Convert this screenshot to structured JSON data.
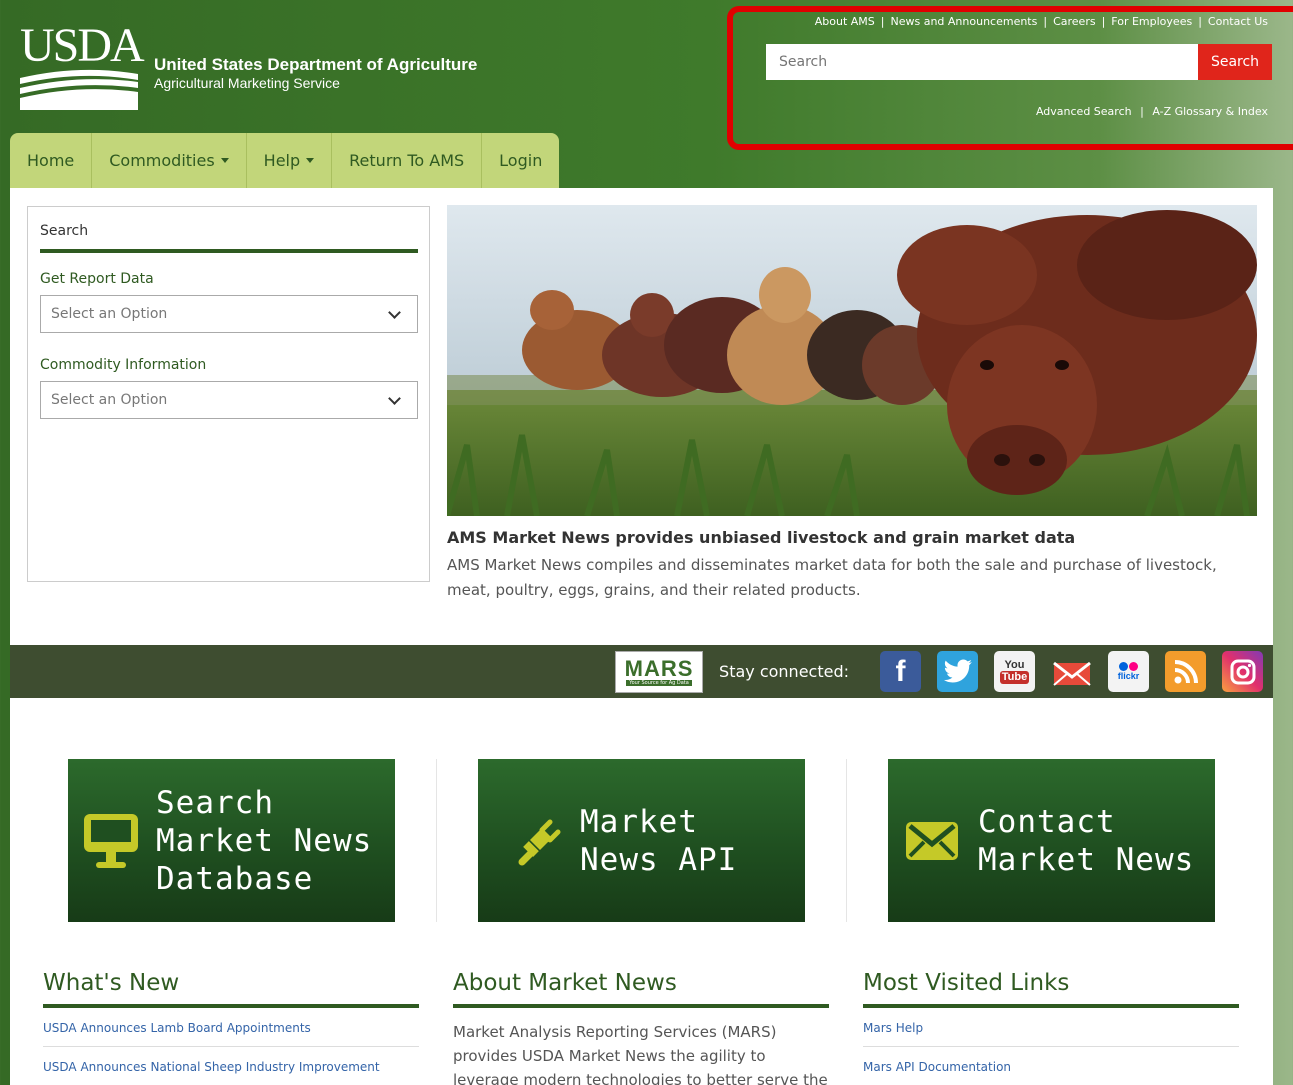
{
  "header": {
    "logo_text": "USDA",
    "agency_name": "United States Department of Agriculture",
    "agency_sub": "Agricultural Marketing Service",
    "top_links": [
      "About AMS",
      "News and Announcements",
      "Careers",
      "For Employees",
      "Contact Us"
    ],
    "search_placeholder": "Search",
    "search_button": "Search",
    "advanced_search": "Advanced Search",
    "glossary": "A-Z Glossary & Index"
  },
  "nav": {
    "items": [
      "Home",
      "Commodities",
      "Help",
      "Return To AMS",
      "Login"
    ]
  },
  "sidebar": {
    "title": "Search",
    "report_label": "Get Report Data",
    "report_select": "Select an Option",
    "commodity_label": "Commodity Information",
    "commodity_select": "Select an Option"
  },
  "hero": {
    "headline": "AMS Market News provides unbiased livestock and grain market data",
    "body": "AMS Market News compiles and disseminates market data for both the sale and purchase of livestock, meat, poultry, eggs, grains, and their related products."
  },
  "social": {
    "mars_logo": "MARS",
    "mars_tagline": "Your Source for Ag Data",
    "stay_connected": "Stay connected:",
    "icons": [
      "facebook-icon",
      "twitter-icon",
      "youtube-icon",
      "email-icon",
      "flickr-icon",
      "rss-icon",
      "instagram-icon"
    ]
  },
  "tiles": {
    "search_db": [
      "Search",
      "Market News",
      "Database"
    ],
    "api": [
      "Market",
      "News API"
    ],
    "contact": [
      "Contact",
      "Market News"
    ]
  },
  "whats_new": {
    "title": "What's New",
    "links": [
      "USDA Announces Lamb Board Appointments",
      "USDA Announces National Sheep Industry Improvement"
    ]
  },
  "about": {
    "title": "About Market News",
    "text": "Market Analysis Reporting Services (MARS) provides USDA Market News the agility to leverage modern technologies to better serve the"
  },
  "most_visited": {
    "title": "Most Visited Links",
    "links": [
      "Mars Help",
      "Mars API Documentation"
    ]
  },
  "colors": {
    "header_green": "#3f7a2b",
    "nav_green": "#c2d67a",
    "accent_red": "#e0251b",
    "dark_green": "#2f5a21"
  }
}
